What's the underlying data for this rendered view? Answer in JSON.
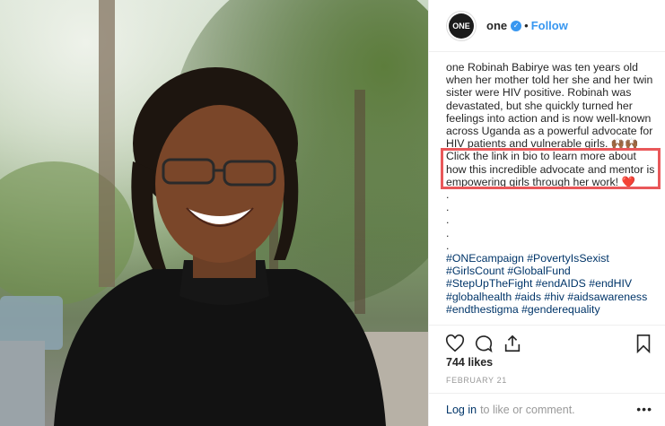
{
  "post": {
    "username": "one",
    "avatar_text": "ONE",
    "follow_label": "Follow",
    "separator": "•",
    "caption_author": "one",
    "caption_intro": "Robinah Babirye was ten years old when her mother told her she and her twin sister were HIV positive. Robinah was devastated, but she quickly turned her feelings into action and is now well-known across Uganda as a powerful advocate for HIV patients and vulnerable girls. 🙌🏾🙌🏾",
    "caption_highlight": "Click the link in bio to learn more about how this incredible advocate and mentor is empowering girls through her work! ❤️",
    "caption_dots": [
      ".",
      ".",
      ".",
      ".",
      "."
    ],
    "hashtags_lines": [
      "#ONEcampaign #PovertyIsSexist",
      "#GirlsCount #GlobalFund",
      "#StepUpTheFight #endAIDS #endHIV",
      "#globalhealth #aids #hiv #aidsawareness",
      "#endthestigma #genderequality"
    ],
    "likes": "744 likes",
    "date": "FEBRUARY 21",
    "login_label": "Log in",
    "login_rest": "to like or comment.",
    "more_label": "•••"
  },
  "icons": {
    "verified": "verified-badge-icon",
    "like": "heart-icon",
    "comment": "comment-icon",
    "share": "share-icon",
    "save": "bookmark-icon"
  },
  "colors": {
    "accent_blue": "#3897f0",
    "hashtag_blue": "#003569",
    "highlight_red": "#e9585a"
  }
}
